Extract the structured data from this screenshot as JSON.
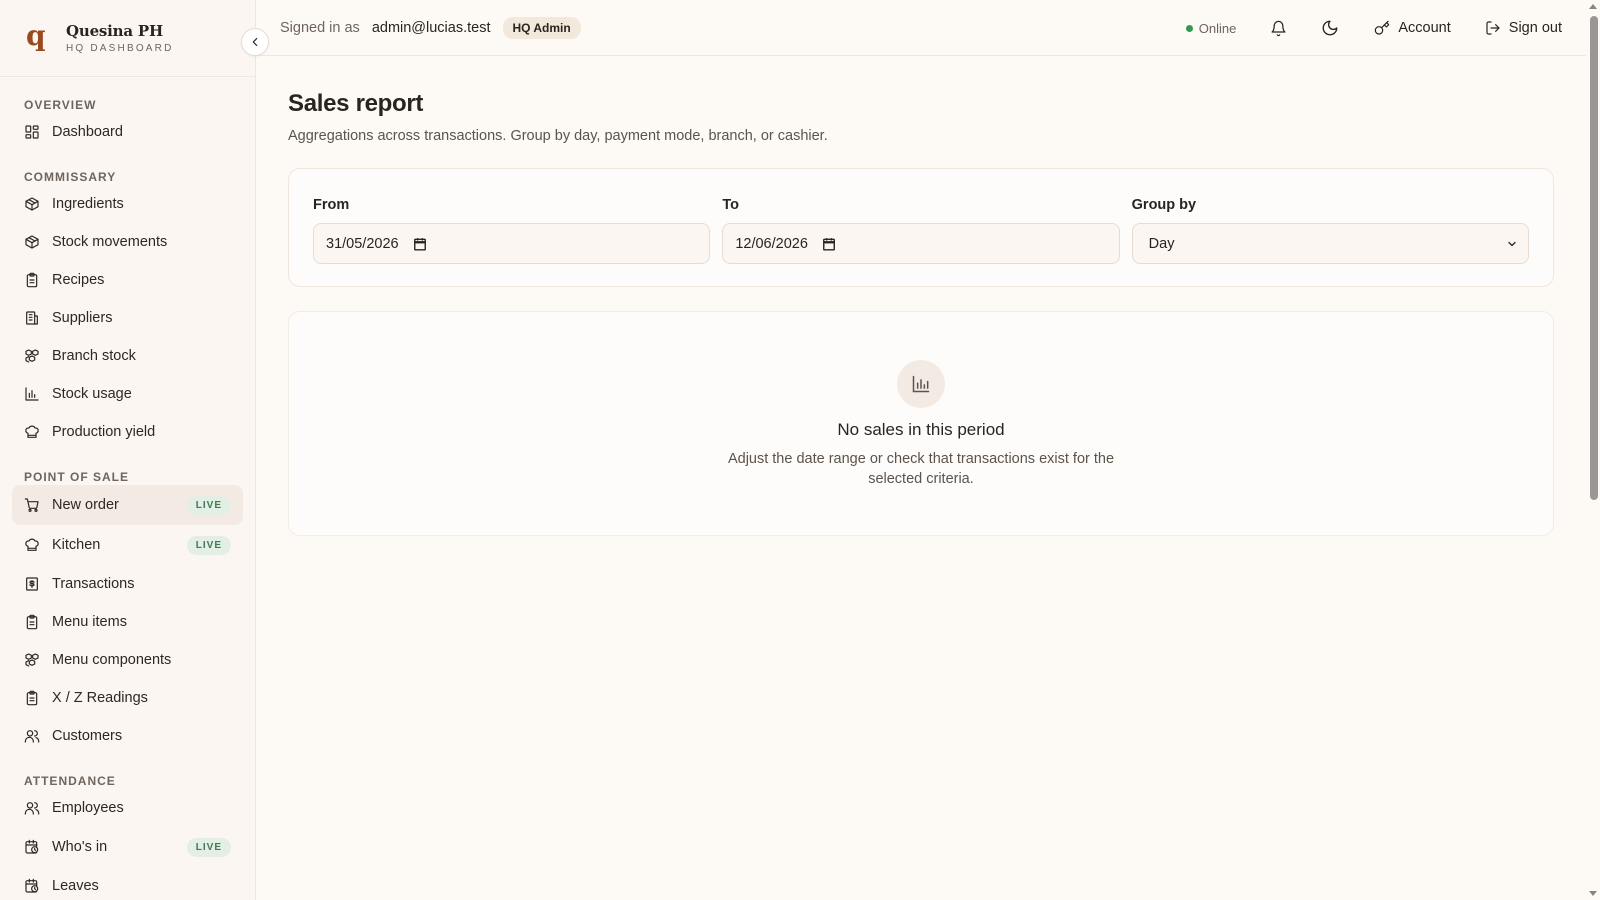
{
  "brand": {
    "logo_letter": "q",
    "name": "Quesina PH",
    "subtitle": "HQ DASHBOARD"
  },
  "sidebar": {
    "collapse_icon": "chevron-left-icon",
    "sections": [
      {
        "title": "OVERVIEW",
        "items": [
          {
            "label": "Dashboard",
            "icon": "grid-icon"
          }
        ]
      },
      {
        "title": "COMMISSARY",
        "items": [
          {
            "label": "Ingredients",
            "icon": "package-icon"
          },
          {
            "label": "Stock movements",
            "icon": "package-icon"
          },
          {
            "label": "Recipes",
            "icon": "clipboard-icon"
          },
          {
            "label": "Suppliers",
            "icon": "building-icon"
          },
          {
            "label": "Branch stock",
            "icon": "boxes-icon"
          },
          {
            "label": "Stock usage",
            "icon": "bar-chart-icon"
          },
          {
            "label": "Production yield",
            "icon": "chef-hat-icon"
          }
        ]
      },
      {
        "title": "POINT OF SALE",
        "items": [
          {
            "label": "New order",
            "icon": "cart-icon",
            "badge": "LIVE",
            "active": true
          },
          {
            "label": "Kitchen",
            "icon": "chef-hat-icon",
            "badge": "LIVE"
          },
          {
            "label": "Transactions",
            "icon": "receipt-icon"
          },
          {
            "label": "Menu items",
            "icon": "clipboard-icon"
          },
          {
            "label": "Menu components",
            "icon": "boxes-icon"
          },
          {
            "label": "X / Z Readings",
            "icon": "clipboard-icon"
          },
          {
            "label": "Customers",
            "icon": "users-icon"
          }
        ]
      },
      {
        "title": "ATTENDANCE",
        "items": [
          {
            "label": "Employees",
            "icon": "users-icon"
          },
          {
            "label": "Who's in",
            "icon": "calendar-clock-icon",
            "badge": "LIVE"
          },
          {
            "label": "Leaves",
            "icon": "calendar-clock-icon"
          }
        ]
      }
    ]
  },
  "topbar": {
    "signed_in_label": "Signed in as",
    "email": "admin@lucias.test",
    "role": "HQ Admin",
    "status": "Online",
    "status_color": "#2f9a52",
    "account_label": "Account",
    "signout_label": "Sign out"
  },
  "page": {
    "title": "Sales report",
    "subtitle": "Aggregations across transactions. Group by day, payment mode, branch, or cashier."
  },
  "filters": {
    "from_label": "From",
    "from_value": "31/05/2026",
    "to_label": "To",
    "to_value": "12/06/2026",
    "group_label": "Group by",
    "group_value": "Day"
  },
  "empty_state": {
    "icon": "bar-chart-icon",
    "title": "No sales in this period",
    "description": "Adjust the date range or check that transactions exist for the selected criteria."
  }
}
